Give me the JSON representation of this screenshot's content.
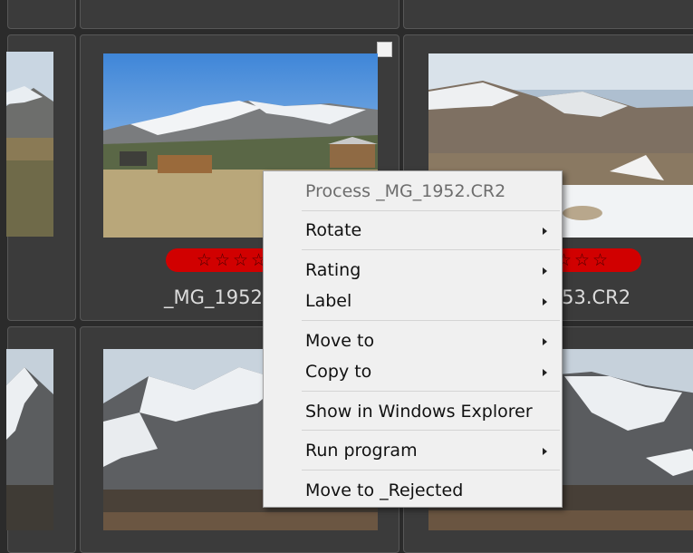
{
  "thumbnails": [
    {
      "filename": "",
      "stars": 0
    },
    {
      "filename": "_MG_1952.CR2",
      "stars": 5,
      "star_glyphs": "☆☆☆☆☆"
    },
    {
      "filename": "_MG_1953.CR2",
      "stars": 5,
      "star_glyphs": "☆☆☆☆☆"
    }
  ],
  "context_menu": {
    "header": "Process _MG_1952.CR2",
    "items": [
      {
        "label": "Rotate",
        "submenu": true
      },
      {
        "label": "Rating",
        "submenu": true
      },
      {
        "label": "Label",
        "submenu": true
      },
      {
        "label": "Move to",
        "submenu": true
      },
      {
        "label": "Copy to",
        "submenu": true
      },
      {
        "label": "Show in Windows Explorer",
        "submenu": false
      },
      {
        "label": "Run program",
        "submenu": true
      },
      {
        "label": "Move to _Rejected",
        "submenu": false
      }
    ]
  },
  "colors": {
    "background": "#2b2b2b",
    "cell": "#3b3b3b",
    "rating_pill": "#d10000",
    "menu_bg": "#f0f0f0"
  }
}
